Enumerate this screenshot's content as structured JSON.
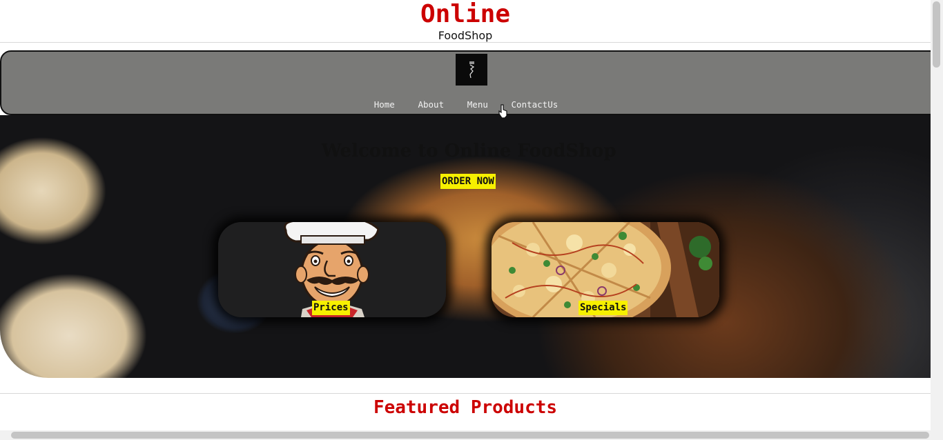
{
  "header": {
    "title": "Online",
    "subtitle": "FoodShop"
  },
  "navbar": {
    "logo_icon": "fork-logo-icon",
    "links": [
      "Home",
      "About",
      "Menu",
      "ContactUs"
    ]
  },
  "hero": {
    "title": "Welcome to Online FoodShop",
    "cta_label": "ORDER NOW",
    "cards": [
      {
        "label": "Prices",
        "icon": "chef-mascot-icon"
      },
      {
        "label": "Specials",
        "icon": "pizza-image"
      }
    ]
  },
  "featured": {
    "title": "Featured Products"
  },
  "colors": {
    "brand_red": "#cc0000",
    "highlight_yellow": "#f7f000",
    "navbar_gray": "#7a7a78"
  }
}
